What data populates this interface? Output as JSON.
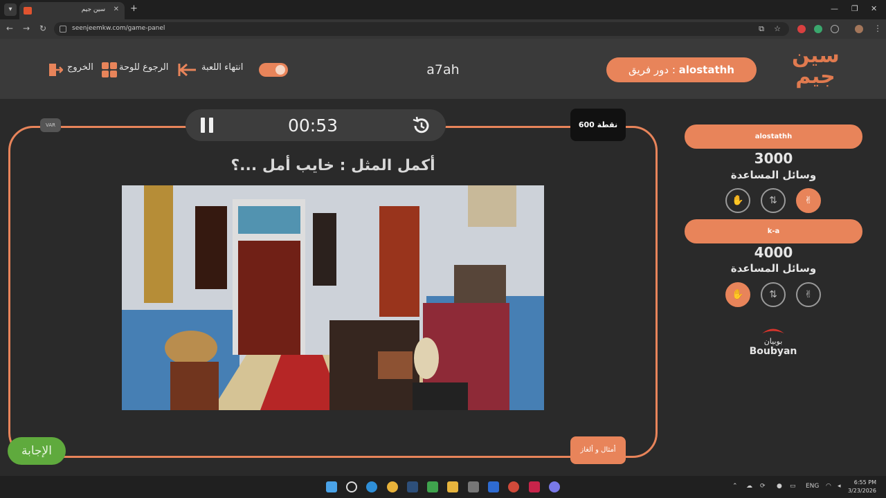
{
  "browser": {
    "tab_title": "سين جيم",
    "url": "seenjeemkw.com/game-panel"
  },
  "header": {
    "logo_text": "سين جيم",
    "turn_label": "دور فريق :",
    "turn_team": "alostathh",
    "game_name": "a7ah",
    "end_game_label": "انتهاء اللعبة",
    "back_to_board_label": "الرجوع للوحة",
    "exit_label": "الخروج"
  },
  "game": {
    "var_label": "VAR",
    "timer": "00:53",
    "points_label": "600 نقطة",
    "question": "أكمل المثل : خايب أمل ...؟",
    "answer_label": "الإجابة",
    "category_label": "أمثال و ألغاز"
  },
  "teams": [
    {
      "name": "alostathh",
      "score": "3000",
      "helps_label": "وسائل المساعدة"
    },
    {
      "name": "k-a",
      "score": "4000",
      "helps_label": "وسائل المساعدة"
    }
  ],
  "sponsor": {
    "name_ar": "بوبيان",
    "name_en": "Boubyan"
  },
  "taskbar": {
    "language": "ENG",
    "time": "6:55 PM",
    "date": "3/23/2026"
  },
  "colors": {
    "accent": "#e8845a",
    "answer_green": "#5faa3d",
    "background": "#2a2a2a"
  }
}
